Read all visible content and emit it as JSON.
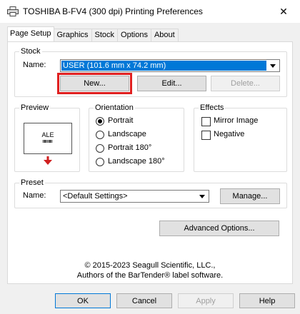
{
  "window": {
    "title": "TOSHIBA B-FV4 (300 dpi) Printing Preferences",
    "close_glyph": "✕"
  },
  "tabs": [
    {
      "label": "Page Setup",
      "active": true
    },
    {
      "label": "Graphics",
      "active": false
    },
    {
      "label": "Stock",
      "active": false
    },
    {
      "label": "Options",
      "active": false
    },
    {
      "label": "About",
      "active": false
    }
  ],
  "stock": {
    "group_label": "Stock",
    "name_label": "Name:",
    "name_value": "USER (101.6 mm x 74.2 mm)",
    "new_button": "New...",
    "edit_button": "Edit...",
    "delete_button": "Delete..."
  },
  "preview": {
    "group_label": "Preview",
    "sample_text": "ALE"
  },
  "orientation": {
    "group_label": "Orientation",
    "options": [
      "Portrait",
      "Landscape",
      "Portrait 180°",
      "Landscape 180°"
    ],
    "selected": "Portrait"
  },
  "effects": {
    "group_label": "Effects",
    "mirror_image": "Mirror Image",
    "negative": "Negative"
  },
  "preset": {
    "group_label": "Preset",
    "name_label": "Name:",
    "name_value": "<Default Settings>",
    "manage_button": "Manage..."
  },
  "advanced_button": "Advanced Options...",
  "copyright": {
    "line1": "© 2015-2023 Seagull Scientific, LLC.,",
    "line2": "Authors of the BarTender® label software."
  },
  "footer": {
    "ok": "OK",
    "cancel": "Cancel",
    "apply": "Apply",
    "help": "Help"
  },
  "colors": {
    "accent": "#0078d7",
    "highlight": "#e02020"
  }
}
